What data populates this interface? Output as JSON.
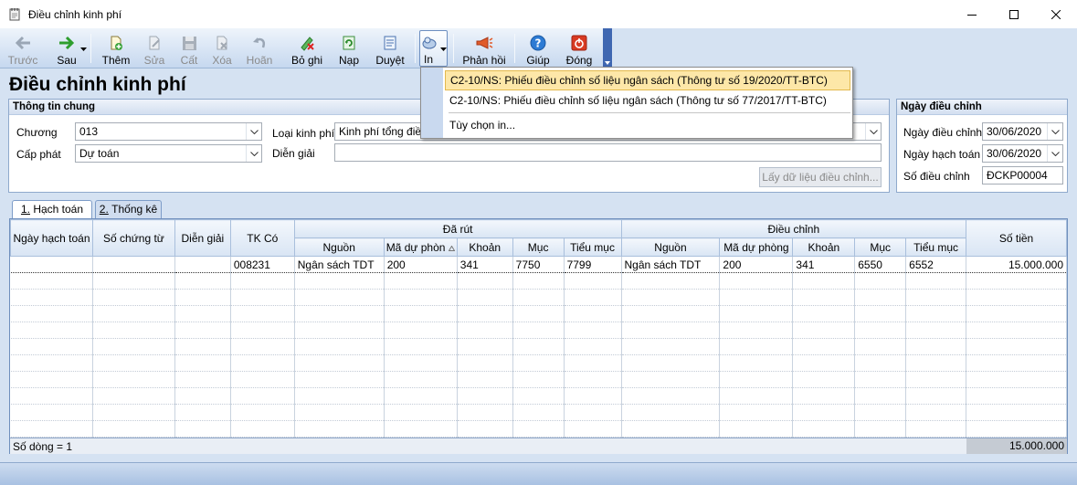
{
  "window": {
    "title": "Điều chỉnh kinh phí"
  },
  "toolbar": {
    "buttons": [
      {
        "label": "Trước",
        "icon": "arrow-left-icon",
        "enabled": false
      },
      {
        "label": "Sau",
        "icon": "arrow-right-icon",
        "enabled": true
      },
      {
        "label": "Thêm",
        "icon": "add-document-icon",
        "enabled": true
      },
      {
        "label": "Sửa",
        "icon": "edit-icon",
        "enabled": false
      },
      {
        "label": "Cất",
        "icon": "save-icon",
        "enabled": false
      },
      {
        "label": "Xóa",
        "icon": "delete-icon",
        "enabled": false
      },
      {
        "label": "Hoãn",
        "icon": "undo-icon",
        "enabled": false
      },
      {
        "label": "Bỏ ghi",
        "icon": "unpost-icon",
        "enabled": true
      },
      {
        "label": "Nạp",
        "icon": "refresh-icon",
        "enabled": true
      },
      {
        "label": "Duyệt",
        "icon": "approve-icon",
        "enabled": true
      },
      {
        "label": "In",
        "icon": "print-icon",
        "enabled": true
      },
      {
        "label": "Phản hồi",
        "icon": "feedback-icon",
        "enabled": true
      },
      {
        "label": "Giúp",
        "icon": "help-icon",
        "enabled": true
      },
      {
        "label": "Đóng",
        "icon": "close-icon",
        "enabled": true
      }
    ]
  },
  "print_menu": {
    "items": [
      "C2-10/NS: Phiếu điều chỉnh số liệu ngân sách (Thông tư số 19/2020/TT-BTC)",
      "C2-10/NS: Phiếu điều chỉnh số liệu ngân sách (Thông tư số 77/2017/TT-BTC)",
      "Tùy chọn in..."
    ]
  },
  "page_title": "Điều chỉnh kinh phí",
  "general": {
    "header": "Thông tin chung",
    "chuong_label": "Chương",
    "chuong_value": "013",
    "capphat_label": "Cấp phát",
    "capphat_value": "Dự toán",
    "loaikp_label": "Loại kinh phí",
    "loaikp_value": "Kinh phí tổng điều",
    "diengiai_label": "Diễn giải",
    "diengiai_value": "",
    "fetch_button": "Lấy dữ liệu điều chỉnh..."
  },
  "dates": {
    "header": "Ngày điều chỉnh",
    "ngay_dieu_chinh_label": "Ngày điều chỉnh",
    "ngay_dieu_chinh_value": "30/06/2020",
    "ngay_hach_toan_label": "Ngày hạch toán",
    "ngay_hach_toan_value": "30/06/2020",
    "so_dieu_chinh_label": "Số điều chỉnh",
    "so_dieu_chinh_value": "ĐCKP00004"
  },
  "tabs": [
    {
      "prefix": "1.",
      "label": "Hạch toán"
    },
    {
      "prefix": "2.",
      "label": "Thống kê"
    }
  ],
  "grid": {
    "top_headers": {
      "ngay_hach_toan": "Ngày hạch toán",
      "so_chung_tu": "Số chứng từ",
      "dien_giai": "Diễn giải",
      "tk_co": "TK Có",
      "da_rut": "Đã rút",
      "dieu_chinh": "Điều chỉnh",
      "so_tien": "Số tiền"
    },
    "sub_headers": {
      "nguon": "Nguồn",
      "ma_du_phong_truncated": "Mã dự phòn",
      "ma_du_phong": "Mã dự phòng",
      "khoan": "Khoản",
      "muc": "Mục",
      "tieu_muc": "Tiểu mục"
    },
    "rows": [
      {
        "ngay_hach_toan": "",
        "so_chung_tu": "",
        "dien_giai": "",
        "tk_co": "008231",
        "dr_nguon": "Ngân sách  TDT",
        "dr_ma_du_phong": "200",
        "dr_khoan": "341",
        "dr_muc": "7750",
        "dr_tieu_muc": "7799",
        "dc_nguon": "Ngân sách  TDT",
        "dc_ma_du_phong": "200",
        "dc_khoan": "341",
        "dc_muc": "6550",
        "dc_tieu_muc": "6552",
        "so_tien": "15.000.000"
      }
    ],
    "footer_count": "Số dòng = 1",
    "footer_total": "15.000.000"
  }
}
